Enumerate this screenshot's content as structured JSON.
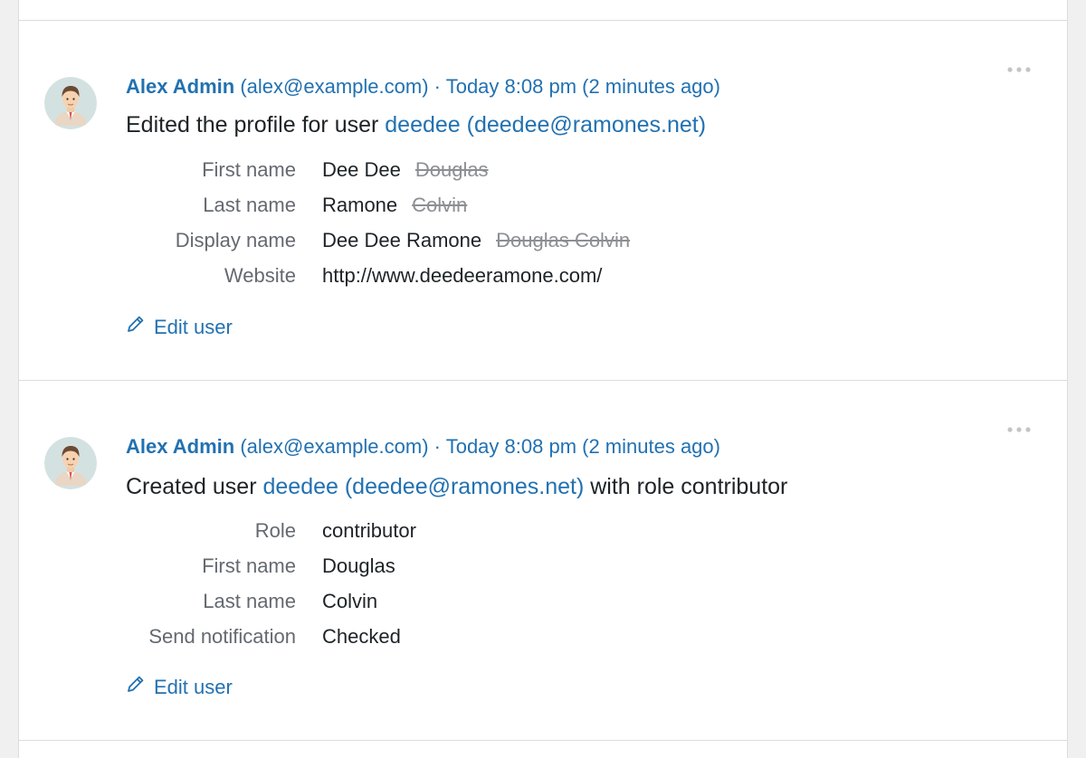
{
  "colors": {
    "link": "#2271b1",
    "text": "#1d2327",
    "label": "#646970",
    "strike": "#8c8f94",
    "border": "#dcdcde",
    "background": "#f0f0f1"
  },
  "entries": [
    {
      "author_name": "Alex Admin",
      "author_email": "(alex@example.com)",
      "separator": "·",
      "time": "Today 8:08 pm (2 minutes ago)",
      "message_prefix": "Edited the profile for user",
      "message_user_link": "deedee (deedee@ramones.net)",
      "message_suffix": "",
      "details": [
        {
          "label": "First name",
          "value": "Dee Dee",
          "old": "Douglas"
        },
        {
          "label": "Last name",
          "value": "Ramone",
          "old": "Colvin"
        },
        {
          "label": "Display name",
          "value": "Dee Dee Ramone",
          "old": "Douglas Colvin"
        },
        {
          "label": "Website",
          "value": "http://www.deedeeramone.com/",
          "old": ""
        }
      ],
      "action_label": "Edit user",
      "action_icon": "pencil-icon",
      "menu_icon": "more-dots-icon"
    },
    {
      "author_name": "Alex Admin",
      "author_email": "(alex@example.com)",
      "separator": "·",
      "time": "Today 8:08 pm (2 minutes ago)",
      "message_prefix": "Created user",
      "message_user_link": "deedee (deedee@ramones.net)",
      "message_suffix": "with role contributor",
      "details": [
        {
          "label": "Role",
          "value": "contributor",
          "old": ""
        },
        {
          "label": "First name",
          "value": "Douglas",
          "old": ""
        },
        {
          "label": "Last name",
          "value": "Colvin",
          "old": ""
        },
        {
          "label": "Send notification",
          "value": "Checked",
          "old": ""
        }
      ],
      "action_label": "Edit user",
      "action_icon": "pencil-icon",
      "menu_icon": "more-dots-icon"
    }
  ]
}
